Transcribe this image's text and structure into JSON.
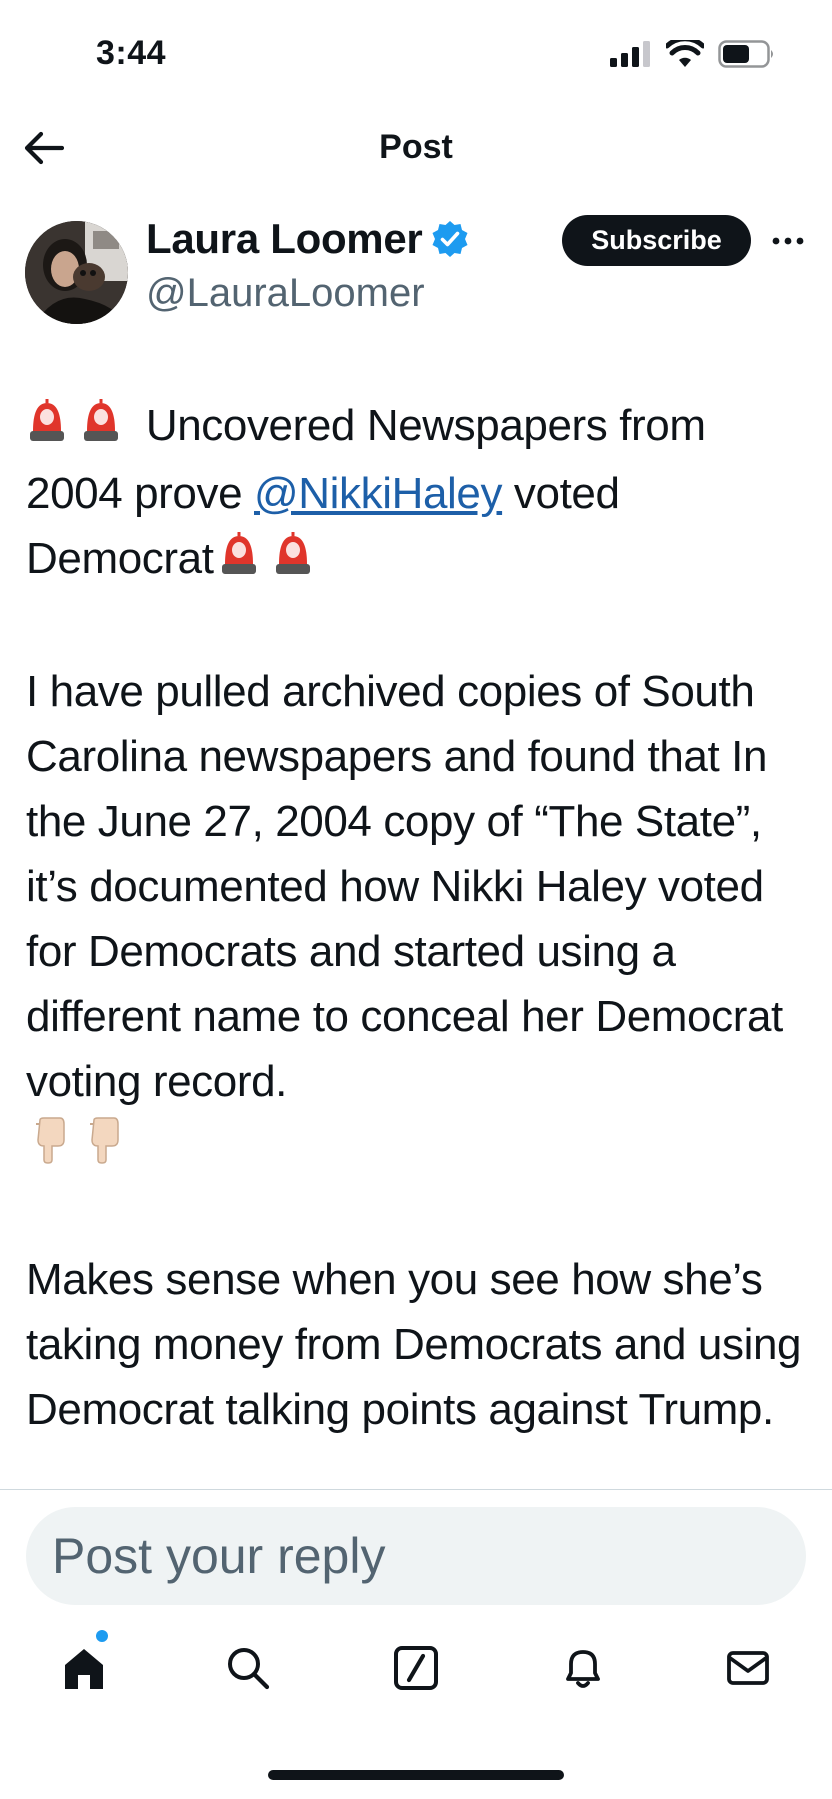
{
  "status_bar": {
    "time": "3:44"
  },
  "header": {
    "title": "Post"
  },
  "author": {
    "name": "Laura Loomer",
    "handle": "@LauraLoomer",
    "verified": true,
    "subscribe_label": "Subscribe"
  },
  "post": {
    "line1_text": " Uncovered Newspapers from",
    "line2_pre": "2004 prove ",
    "mention": "@NikkiHaley",
    "line2_post": " voted",
    "line3_text": "Democrat",
    "para2": "I have pulled archived copies of South Carolina newspapers and found that In the June 27, 2004 copy of “The State”, it’s documented how Nikki Haley voted for Democrats and started using a different name to conceal her Democrat voting record.",
    "para3": "Makes sense when you see how she’s taking money from Democrats and using Democrat talking points against Trump."
  },
  "reply": {
    "placeholder": "Post your reply"
  },
  "nav": {
    "items": [
      "home-icon",
      "search-icon",
      "compose-icon",
      "bell-icon",
      "mail-icon"
    ],
    "active": "home-icon"
  },
  "colors": {
    "text": "#0f1419",
    "secondary": "#536471",
    "link": "#1d5fa8",
    "verified_blue": "#1d9bf0",
    "reply_bg": "#eff3f4"
  }
}
